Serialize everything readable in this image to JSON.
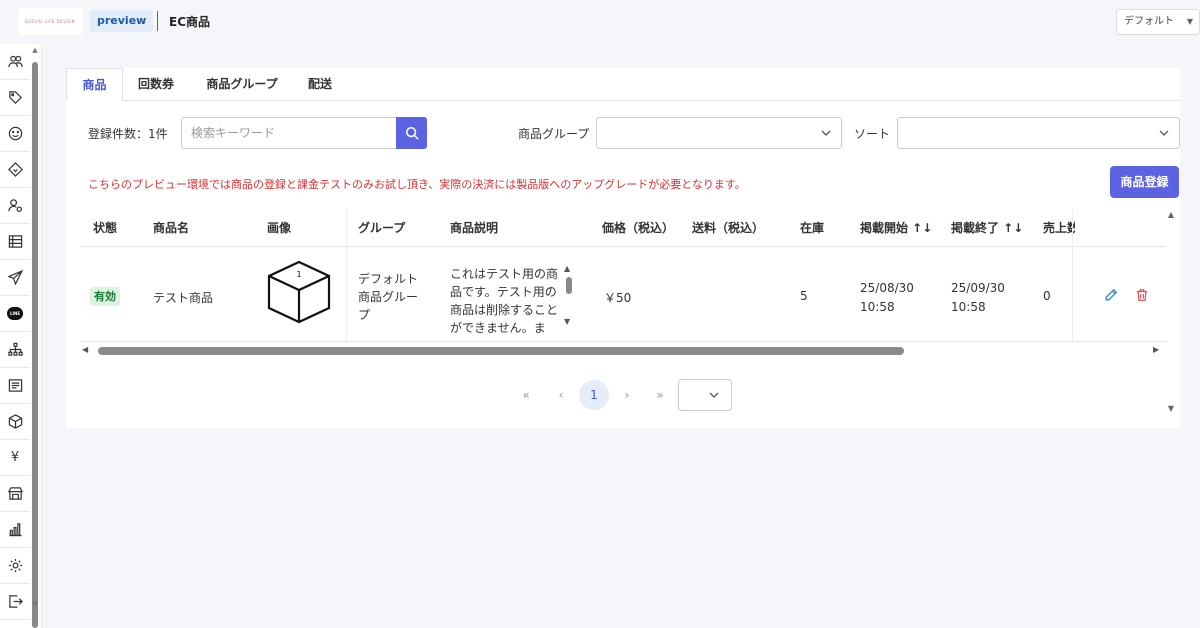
{
  "header": {
    "logo_text": "SUZURI LIFE DESIGN",
    "badge": "preview",
    "title": "EC商品",
    "language": "デフォルト",
    "language_chevron": "chevron-down-icon"
  },
  "sidebar": {
    "items": [
      {
        "icon": "users-icon"
      },
      {
        "icon": "tag-icon"
      },
      {
        "icon": "smile-icon"
      },
      {
        "icon": "ticket-icon"
      },
      {
        "icon": "user-settings-icon"
      },
      {
        "icon": "list-icon"
      },
      {
        "icon": "send-icon"
      },
      {
        "icon": "line-icon",
        "label": "LINE"
      },
      {
        "icon": "hierarchy-icon"
      },
      {
        "icon": "form-icon"
      },
      {
        "icon": "box-icon"
      },
      {
        "icon": "yen-icon",
        "label": "¥"
      },
      {
        "icon": "store-icon"
      },
      {
        "icon": "chart-icon"
      },
      {
        "icon": "gear-icon"
      },
      {
        "icon": "export-icon"
      }
    ]
  },
  "tabs": [
    {
      "label": "商品",
      "active": true
    },
    {
      "label": "回数券",
      "active": false
    },
    {
      "label": "商品グループ",
      "active": false
    },
    {
      "label": "配送",
      "active": false
    }
  ],
  "filters": {
    "count_label": "登録件数：1件",
    "search_placeholder": "検索キーワード",
    "search_icon": "search-icon",
    "group_label": "商品グループ",
    "group_value": "",
    "sort_label": "ソート",
    "sort_value": ""
  },
  "notice": "こちらのプレビュー環境では商品の登録と課金テストのみお試し頂き、実際の決済には製品版へのアップグレードが必要となります。",
  "register_button": "商品登録",
  "table": {
    "headers": {
      "status": "状態",
      "name": "商品名",
      "image": "画像",
      "group": "グループ",
      "description": "商品説明",
      "price": "価格（税込）",
      "shipping": "送料（税込）",
      "stock": "在庫",
      "start": "掲載開始 ↑↓",
      "end": "掲載終了 ↑↓",
      "sales": "売上数"
    },
    "rows": [
      {
        "status": "有効",
        "name": "テスト商品",
        "image_icon": "box-icon",
        "image_number": "1",
        "group": "デフォルト商品グループ",
        "description": "これはテスト用の商品です。テスト用の商品は削除することができません。ま",
        "price": "￥50",
        "shipping": "",
        "stock": "5",
        "start_date": "25/08/30",
        "start_time": "10:58",
        "end_date": "25/09/30",
        "end_time": "10:58",
        "sales": "0",
        "edit_icon": "pencil-icon",
        "delete_icon": "trash-icon"
      }
    ]
  },
  "pagination": {
    "first": "«",
    "prev": "‹",
    "current": "1",
    "next": "›",
    "last": "»",
    "page_size": ""
  },
  "colors": {
    "accent": "#5b63e3",
    "notice": "#d93030",
    "status_active_bg": "#dcf3df",
    "status_active_text": "#1c7a33"
  }
}
